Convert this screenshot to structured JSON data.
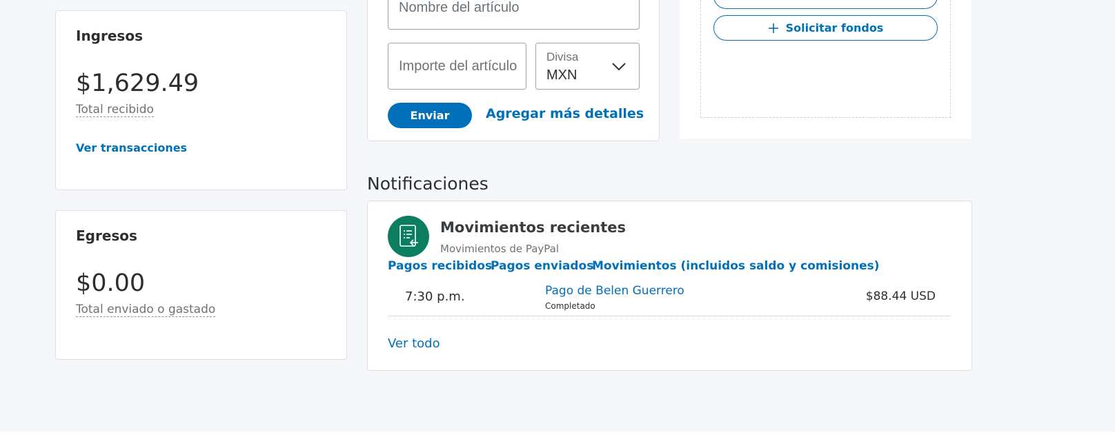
{
  "income_card": {
    "title": "Ingresos",
    "amount": "$1,629.49",
    "amount_label": "Total recibido",
    "link": "Ver transacciones"
  },
  "expense_card": {
    "title": "Egresos",
    "amount": "$0.00",
    "amount_label": "Total enviado o gastado"
  },
  "invoice_form": {
    "item_name_placeholder": "Nombre del artículo",
    "item_amount_placeholder": "Importe del artículo",
    "currency_label": "Divisa",
    "currency_value": "MXN",
    "send_button": "Enviar",
    "more_details_link": "Agregar más detalles"
  },
  "quick_actions": {
    "request_funds_button": "Solicitar fondos"
  },
  "notifications": {
    "section_title": "Notificaciones",
    "card_title": "Movimientos recientes",
    "card_subtitle": "Movimientos de PayPal",
    "tabs": [
      {
        "label": "Pagos recibidos"
      },
      {
        "label": "Pagos enviados"
      },
      {
        "label": "Movimientos (incluidos saldo y comisiones)"
      }
    ],
    "transactions": [
      {
        "time": "7:30 p.m.",
        "title": "Pago de Belen Guerrero",
        "status": "Completado",
        "amount": "$88.44 USD"
      }
    ],
    "view_all_link": "Ver todo"
  },
  "colors": {
    "accent": "#0070ba",
    "activity_icon_bg": "#0b7e5f",
    "page_background": "#f5f7fa"
  }
}
